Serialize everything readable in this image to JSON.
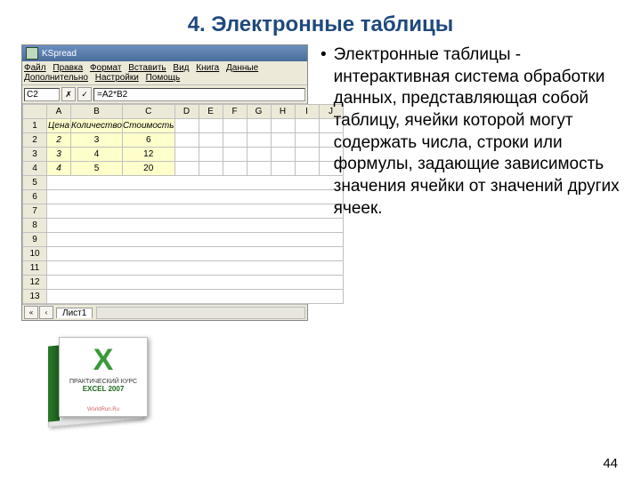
{
  "slide": {
    "title": "4. Электронные таблицы",
    "pageNumber": "44"
  },
  "bullet_text": "Электронные таблицы - интерактивная система обработки данных, представляющая собой таблицу, ячейки которой могут содержать числа, строки или формулы, задающие зависимость значения ячейки от значений других ячеек.",
  "spreadsheet": {
    "appName": "KSpread",
    "menus": [
      "Файл",
      "Правка",
      "Формат",
      "Вставить",
      "Вид",
      "Книга",
      "Данные",
      "Дополнительно",
      "Настройки",
      "Помощь"
    ],
    "activeCellRef": "C2",
    "formula": "=A2*B2",
    "columnHeaders": [
      "A",
      "B",
      "C",
      "D",
      "E",
      "F",
      "G",
      "H",
      "I",
      "J"
    ],
    "rowNumbers": [
      "1",
      "2",
      "3",
      "4",
      "5",
      "6",
      "7",
      "8",
      "9",
      "10",
      "11",
      "12",
      "13"
    ],
    "headerRow": [
      "Цена",
      "Количество",
      "Стоимость"
    ],
    "dataRows": [
      [
        "2",
        "3",
        "6"
      ],
      [
        "3",
        "4",
        "12"
      ],
      [
        "4",
        "5",
        "20"
      ]
    ],
    "sheetName": "Лист1",
    "cancelSymbol": "✗",
    "acceptSymbol": "✓"
  },
  "book": {
    "logo": "X",
    "line1": "ПРАКТИЧЕСКИЙ КУРС",
    "line2": "EXCEL 2007",
    "site": "WorldRun.Ru"
  }
}
